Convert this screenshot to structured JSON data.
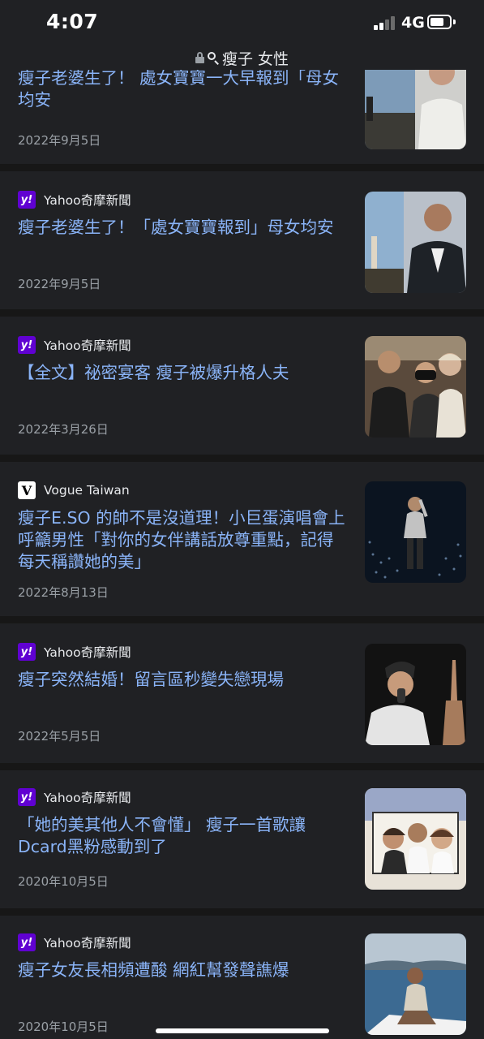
{
  "status": {
    "time": "4:07",
    "network": "4G"
  },
  "urlbar": {
    "query": "瘦子 女性",
    "lock_icon": "lock-icon",
    "search_icon": "search-icon"
  },
  "articles": [
    {
      "source": "",
      "logo": "",
      "headline": "瘦子老婆生了！ 處女寶寶一大早報到「母女均安",
      "date": "2022年9月5日"
    },
    {
      "source": "Yahoo奇摩新聞",
      "logo": "y!",
      "headline": "瘦子老婆生了！「處女寶寶報到」母女均安",
      "date": "2022年9月5日"
    },
    {
      "source": "Yahoo奇摩新聞",
      "logo": "y!",
      "headline": "【全文】祕密宴客 瘦子被爆升格人夫",
      "date": "2022年3月26日"
    },
    {
      "source": "Vogue Taiwan",
      "logo": "V",
      "headline": "瘦子E.SO 的帥不是沒道理！小巨蛋演唱會上呼籲男性「對你的女伴講話放尊重點，記得每天稱讚她的美」",
      "date": "2022年8月13日"
    },
    {
      "source": "Yahoo奇摩新聞",
      "logo": "y!",
      "headline": "瘦子突然結婚！留言區秒變失戀現場",
      "date": "2022年5月5日"
    },
    {
      "source": "Yahoo奇摩新聞",
      "logo": "y!",
      "headline": "「她的美其他人不會懂」 瘦子一首歌讓Dcard黑粉感動到了",
      "date": "2020年10月5日"
    },
    {
      "source": "Yahoo奇摩新聞",
      "logo": "y!",
      "headline": "瘦子女友長相頻遭酸 網紅幫發聲譙爆",
      "date": "2020年10月5日"
    }
  ],
  "colors": {
    "background": "#202124",
    "divider": "#171717",
    "headline": "#8ab4f8",
    "date": "#9aa0a6",
    "yahoo_brand": "#6001d2"
  }
}
